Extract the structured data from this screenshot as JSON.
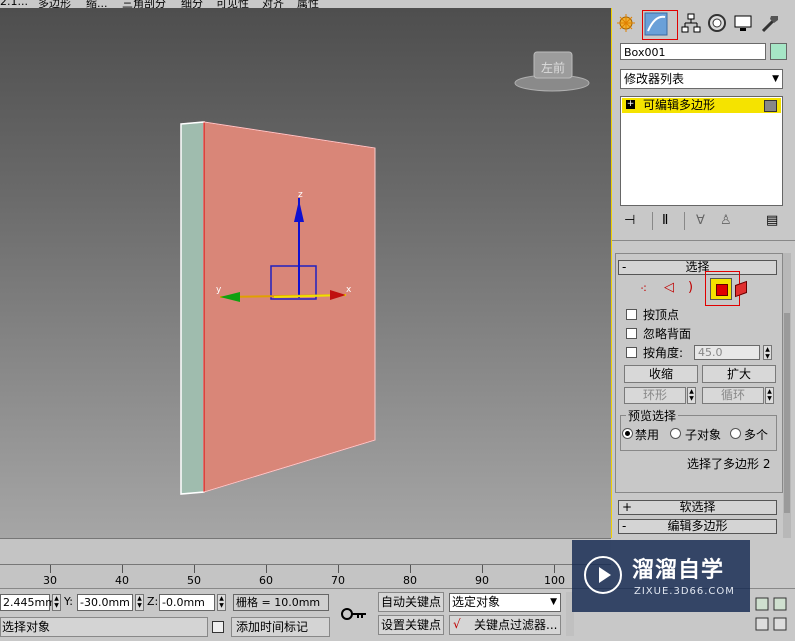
{
  "top_menu": [
    "2.1...",
    "多边形",
    "缩...",
    "三角剖分",
    "细分",
    "可见性",
    "对齐",
    "属性"
  ],
  "viewport": {
    "viewcube_label": "左前",
    "gizmo_x": "x",
    "gizmo_y": "y",
    "gizmo_z": "z"
  },
  "panel": {
    "tabs": [
      "create-icon",
      "modify-icon",
      "hierarchy-icon",
      "motion-icon",
      "display-icon",
      "utilities-icon"
    ],
    "object_name": "Box001",
    "object_color": "#a6e6c6",
    "modifier_list": "修改器列表",
    "stack_item": "可编辑多边形",
    "stack_toolbar": [
      "pin-stack-icon",
      "show-end-result-icon",
      "make-unique-icon",
      "remove-modifier-icon",
      "configure-sets-icon"
    ],
    "selection_rollout": {
      "title": "选择",
      "by_vertex": "按顶点",
      "ignore_backfacing": "忽略背面",
      "by_angle": "按角度:",
      "angle_value": "45.0",
      "shrink": "收缩",
      "grow": "扩大",
      "ring": "环形",
      "loop": "循环",
      "preview_group": "预览选择",
      "preview_disabled": "禁用",
      "preview_subobject": "子对象",
      "preview_multi": "多个",
      "status": "选择了多边形 2"
    },
    "soft_selection": "软选择",
    "edit_polygons": "编辑多边形"
  },
  "timeline": {
    "ticks": [
      "30",
      "40",
      "50",
      "60",
      "70",
      "80",
      "90",
      "100"
    ]
  },
  "status": {
    "x_value": "2.445mm",
    "y_label": "Y:",
    "y_value": "-30.0mm",
    "z_label": "Z:",
    "z_value": "-0.0mm",
    "grid": "栅格 = 10.0mm",
    "auto_key": "自动关键点",
    "selected_object": "选定对象",
    "set_key": "设置关键点",
    "key_filters": "关键点过滤器...",
    "add_time_tag": "添加时间标记",
    "prompt": "选择对象"
  },
  "watermark": {
    "title": "溜溜自学",
    "url": "ZIXUE.3D66.COM"
  },
  "colors": {
    "accent_yellow": "#f0d000",
    "face_red": "#d98678",
    "highlight_red": "#e00000"
  }
}
